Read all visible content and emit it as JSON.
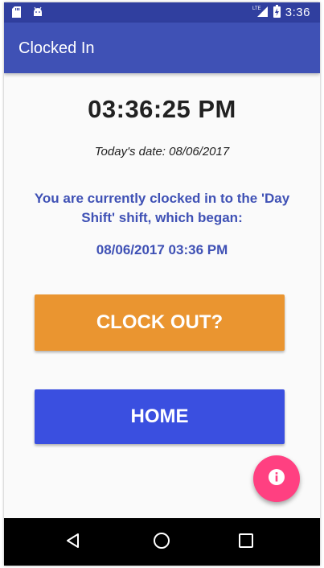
{
  "status_bar": {
    "network": "LTE",
    "time": "3:36"
  },
  "app_bar": {
    "title": "Clocked In"
  },
  "main": {
    "current_time": "03:36:25 PM",
    "todays_date": "Today's date: 08/06/2017",
    "shift_message": "You are currently clocked in to the 'Day Shift' shift, which began:",
    "shift_start": "08/06/2017 03:36 PM"
  },
  "buttons": {
    "clock_out_label": "CLOCK OUT?",
    "home_label": "HOME"
  },
  "fab": {
    "icon": "info-icon"
  },
  "nav": {
    "back_icon": "back-triangle-icon",
    "home_icon": "home-circle-icon",
    "recents_icon": "recents-square-icon"
  },
  "colors": {
    "status_bar": "#303f9f",
    "app_bar": "#3f51b5",
    "accent_text": "#3f51b5",
    "clock_out_button": "#ea9530",
    "home_button": "#3a4fe0",
    "fab": "#ff4081"
  }
}
